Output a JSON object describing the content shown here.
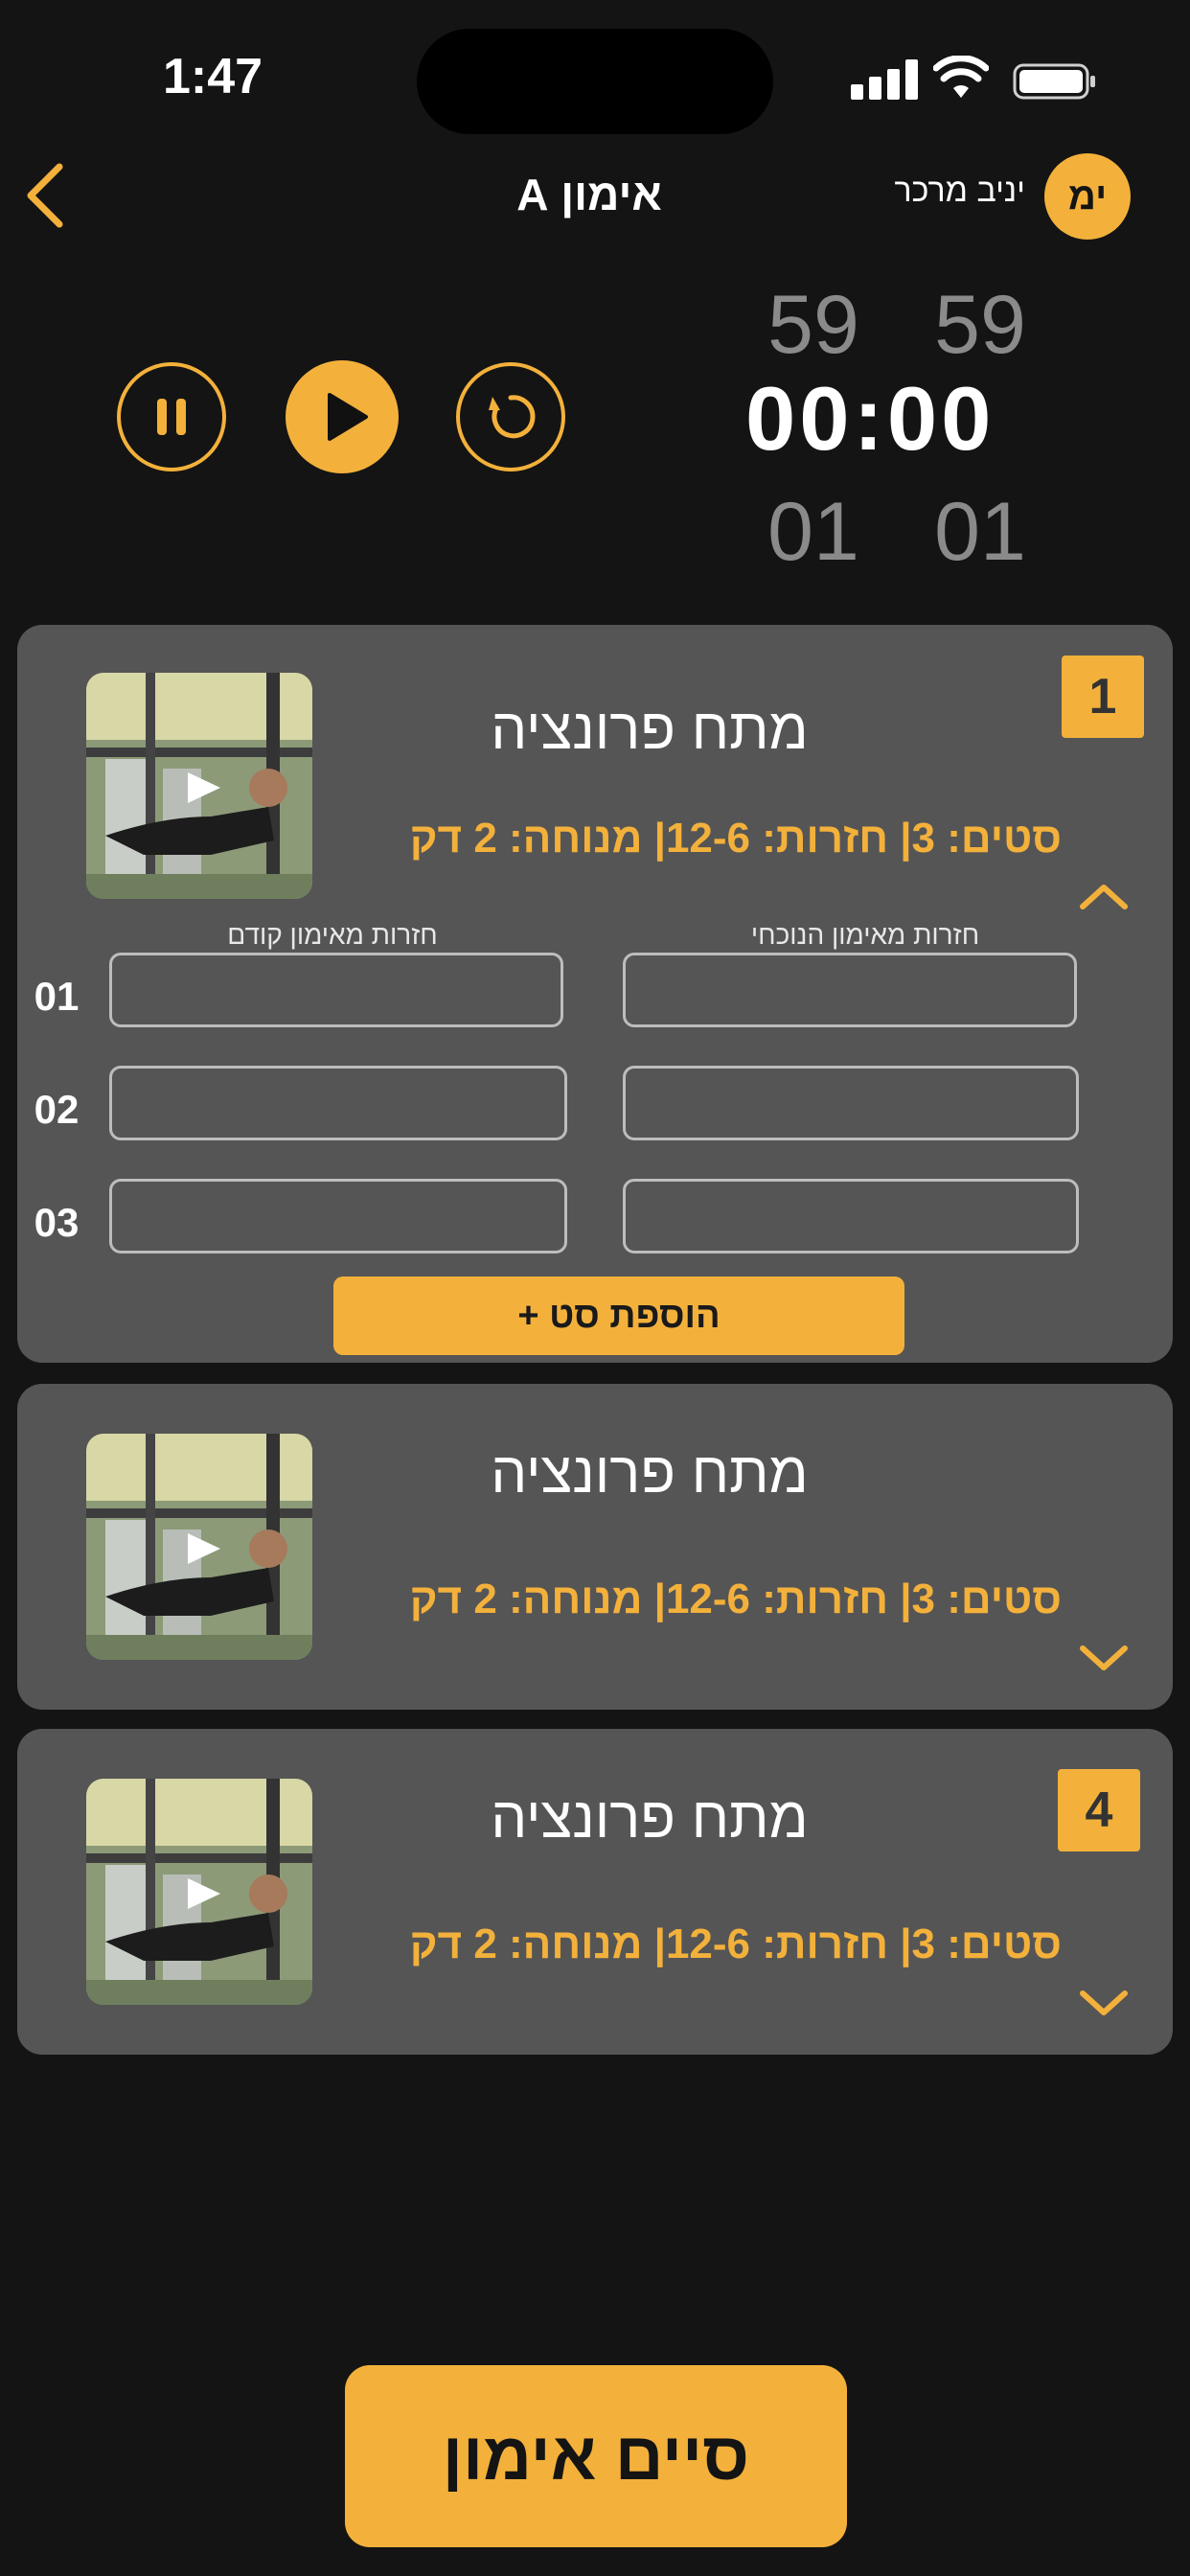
{
  "status_bar": {
    "time": "1:47"
  },
  "header": {
    "back_icon": "chevron-left-icon",
    "title": "אימון A",
    "user_name": "יניב מרכר",
    "user_initials": "ימ"
  },
  "timer": {
    "prev_minutes": "59",
    "prev_seconds": "59",
    "minutes": "00",
    "separator": ":",
    "seconds": "00",
    "next_minutes": "01",
    "next_seconds": "01",
    "controls": [
      "pause-icon",
      "play-icon",
      "restart-icon"
    ]
  },
  "exercises": [
    {
      "index": "1",
      "name": "מתח פרונציה",
      "meta": "סטים: 3| חזרות: 12-6| מנוחה: 2 דק",
      "expanded": true,
      "current_label": "חזרות מאימון הנוכחי",
      "previous_label": "חזרות מאימון קודם",
      "sets": [
        {
          "number": "01",
          "current": "",
          "previous": ""
        },
        {
          "number": "02",
          "current": "",
          "previous": ""
        },
        {
          "number": "03",
          "current": "",
          "previous": ""
        }
      ],
      "add_set_label": "הוספת סט +"
    },
    {
      "index": "",
      "name": "מתח פרונציה",
      "meta": "סטים: 3| חזרות: 12-6| מנוחה: 2 דק",
      "expanded": false
    },
    {
      "index": "4",
      "name": "מתח פרונציה",
      "meta": "סטים: 3| חזרות: 12-6| מנוחה: 2 דק",
      "expanded": false
    }
  ],
  "finish_button": "סיים אימון",
  "colors": {
    "accent": "#f3b13b",
    "background": "#141414",
    "card": "#555555"
  }
}
